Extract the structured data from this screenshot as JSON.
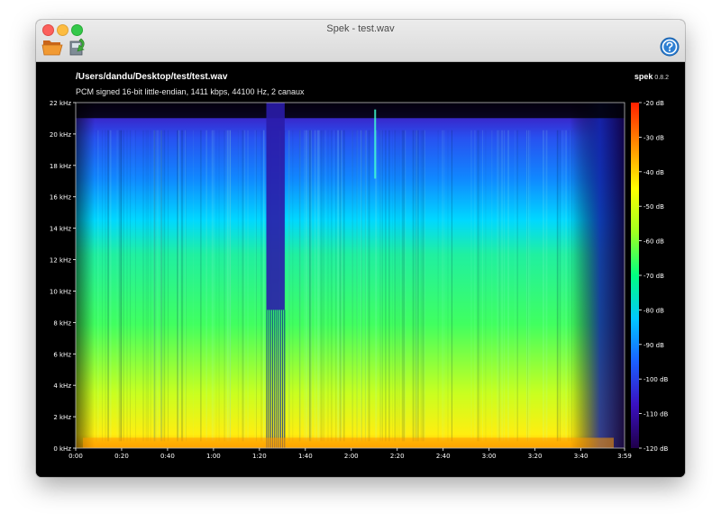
{
  "window": {
    "title": "Spek - test.wav"
  },
  "toolbar": {
    "open_icon": "folder-open-icon",
    "save_icon": "save-export-icon",
    "help_icon": "help-icon"
  },
  "file": {
    "path": "/Users/dandu/Desktop/test/test.wav",
    "info": "PCM signed 16-bit little-endian, 1411 kbps, 44100 Hz, 2 canaux"
  },
  "brand": {
    "name": "spek",
    "version": "0.8.2"
  },
  "chart_data": {
    "type": "heatmap",
    "x_axis": {
      "ticks": [
        "0:00",
        "0:20",
        "0:40",
        "1:00",
        "1:20",
        "1:40",
        "2:00",
        "2:20",
        "2:40",
        "3:00",
        "3:20",
        "3:40",
        "3:59"
      ],
      "range": [
        0,
        239
      ]
    },
    "y_axis": {
      "ticks": [
        "0 kHz",
        "2 kHz",
        "4 kHz",
        "6 kHz",
        "8 kHz",
        "10 kHz",
        "12 kHz",
        "14 kHz",
        "16 kHz",
        "18 kHz",
        "20 kHz",
        "22 kHz"
      ],
      "range": [
        0,
        22
      ]
    },
    "colorbar": {
      "ticks": [
        "-20 dB",
        "-30 dB",
        "-40 dB",
        "-50 dB",
        "-60 dB",
        "-70 dB",
        "-80 dB",
        "-90 dB",
        "-100 dB",
        "-110 dB",
        "-120 dB"
      ],
      "range": [
        -120,
        -20
      ],
      "colors": [
        "#20004a",
        "#3a10c0",
        "#1a60ff",
        "#00c8ff",
        "#00ff80",
        "#a0ff20",
        "#ffff00",
        "#ff9000",
        "#ff2000"
      ]
    }
  }
}
